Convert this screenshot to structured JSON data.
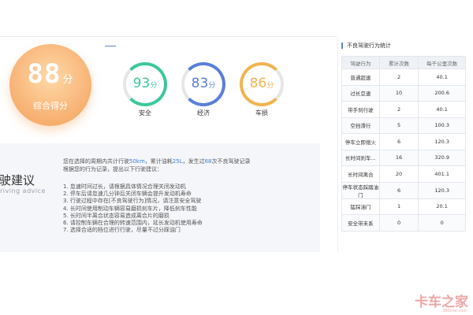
{
  "overall": {
    "score": "88",
    "unit": "分",
    "label": "综合得分"
  },
  "rings": [
    {
      "value": "93",
      "unit": "分",
      "label": "安全",
      "color": "#3bc89b"
    },
    {
      "value": "83",
      "unit": "分",
      "label": "经济",
      "color": "#5b7fd8"
    },
    {
      "value": "86",
      "unit": "分",
      "label": "车损",
      "color": "#f2b34f"
    }
  ],
  "advice": {
    "title": "驾驶建议",
    "subtitle": "riving advice",
    "summary_prefix": "您在选择的周期内共计行驶",
    "mileage": "50km",
    "summary_mid1": "，累计油耗",
    "fuel": "25L",
    "summary_mid2": "，发生过",
    "count": "68",
    "summary_suffix": "次不良驾驶记录",
    "summary_line2": "根据您的行为记录，提出以下行驶建议：",
    "items": [
      "1. 怠速时间过长，请根据具体情况合理关闭发动机",
      "2. 停车后请怠速几分钟后关闭车辆会提升发动机寿命",
      "3. 行驶过程中存在[不良驾驶行为]情况，请注意安全驾驶",
      "4. 长时间使用制动车辆容易磨损刹车片，降低刹车性能",
      "5. 长时间半离合状态容易造成离合片的磨损",
      "6. 请控制车辆在合理的转速范围内，延长发动机使用寿命",
      "7. 选择合适的档位进行行驶，尽量不过分踩油门"
    ]
  },
  "table": {
    "title": "不良驾驶行为统计",
    "headers": [
      "驾驶行为",
      "累计次数",
      "每千公里次数"
    ],
    "rows": [
      [
        "普通超速",
        "2",
        "40.1"
      ],
      [
        "过长怠速",
        "10",
        "200.6"
      ],
      [
        "带手刹行驶",
        "2",
        "40.1"
      ],
      [
        "空挡滑行",
        "5",
        "100.3"
      ],
      [
        "停车立即熄火",
        "6",
        "120.3"
      ],
      [
        "长时间刹车...",
        "16",
        "320.9"
      ],
      [
        "长时间离合",
        "20",
        "401.1"
      ],
      [
        "停车状态踩踏油门",
        "6",
        "120.3"
      ],
      [
        "猛踩油门",
        "1",
        "20.1"
      ],
      [
        "安全带未系",
        "0",
        "0"
      ]
    ]
  },
  "watermark": {
    "text": "卡车之家",
    "sub": "360che.com"
  }
}
